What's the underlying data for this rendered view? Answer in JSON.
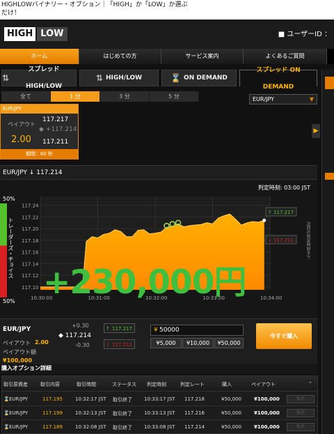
{
  "banner": {
    "line1": "HIGHLOWバイナリー・オプション｜「HIGH」か「LOW」か選ぶ",
    "line2": "だけ！"
  },
  "header": {
    "logo_high": "HIGH",
    "logo_low": "LOW",
    "user_icon": "person-icon",
    "user_label": "ユーザーID ："
  },
  "nav": [
    "ホーム",
    "はじめての方",
    "サービス案内",
    "よくあるご質問"
  ],
  "modes": [
    {
      "label": "スプレッドHIGH/LOW",
      "icon": "arrow-updown-icon"
    },
    {
      "label": "HIGH/LOW",
      "icon": "arrow-updown-icon"
    },
    {
      "label": "ON DEMAND",
      "icon": "hourglass-icon"
    },
    {
      "label": "スプレッド ON DEMAND",
      "icon": "hourglass-icon"
    }
  ],
  "periods": [
    "全て",
    "1 分",
    "3 分",
    "5 分"
  ],
  "pair_select": "EUR/JPY",
  "card": {
    "pair": "EUR/JPY",
    "high_price": "117.217",
    "mid_price": "117.214",
    "low_price": "117.211",
    "payout_label": "ペイアウト",
    "payout_value": "2.00",
    "period": "期間：60 秒"
  },
  "chart_header": {
    "pair": "EUR/JPY",
    "rate": "117.214",
    "judge_label": "判定時刻:",
    "judge_time": "03:00 JST"
  },
  "traders_choice": {
    "label": "トレーダーズ・チョイス",
    "top_pct": "50%",
    "bottom_pct": "50%",
    "up_ratio": 0.5,
    "side_text": "次回の判定時刻まで"
  },
  "chart_data": {
    "type": "area",
    "title": "",
    "xlabel": "",
    "ylabel": "",
    "x_ticks": [
      "10:30:00",
      "10:31:00",
      "10:32:00",
      "10:33:00",
      "10:34:00"
    ],
    "y_ticks": [
      "117.24",
      "117.22",
      "117.20",
      "117.18",
      "117.16",
      "117.14",
      "117.12",
      "117.10"
    ],
    "ylim": [
      117.095,
      117.255
    ],
    "xlim": [
      0,
      240
    ],
    "x": [
      0,
      44,
      48,
      54,
      60,
      66,
      72,
      78,
      84,
      90,
      96,
      102,
      108,
      114,
      120,
      126,
      132,
      138,
      144,
      150,
      156,
      162,
      168,
      174,
      180,
      186,
      192,
      198,
      204,
      210,
      216,
      222,
      228,
      234
    ],
    "values": [
      117.1,
      117.1,
      117.178,
      117.186,
      117.184,
      117.19,
      117.192,
      117.198,
      117.195,
      117.186,
      117.186,
      117.197,
      117.198,
      117.191,
      117.192,
      117.194,
      117.202,
      117.204,
      117.208,
      117.203,
      117.205,
      117.206,
      117.207,
      117.21,
      117.208,
      117.218,
      117.222,
      117.225,
      117.216,
      117.206,
      117.21,
      117.212,
      117.211,
      117.214
    ],
    "high_marker": "117.217",
    "low_marker": "117.211",
    "overlay_text": "+230,000円",
    "grid": true
  },
  "trade": {
    "pair": "EUR/JPY",
    "spread_up": "+0.30",
    "rate": "117.214",
    "spread_down": "-0.30",
    "high_price": "117.217",
    "low_price": "117.211",
    "payout_label": "ペイアウト",
    "payout_value": "2.00",
    "amount_label": "ペイアウト額",
    "amount_value": "¥100,000",
    "input_value": "50000",
    "quick_amounts": [
      "¥5,000",
      "¥10,000",
      "¥50,000"
    ],
    "buy_label": "今すぐ購入"
  },
  "table": {
    "title": "購入オプション詳細",
    "columns": [
      "取引原資産",
      "取引内容",
      "取引時間",
      "ステータス",
      "判定時刻",
      "判定レート",
      "購入",
      "ペイアウト"
    ],
    "rows": [
      {
        "asset": "EUR/JPY",
        "content": "117.195",
        "time": "10:32:17 JST",
        "status": "取引終了",
        "judge": "10:33:17 JST",
        "rate": "117.218",
        "buy": "¥50,000",
        "payout": "¥100,000",
        "action": "転売"
      },
      {
        "asset": "EUR/JPY",
        "content": "117.199",
        "time": "10:32:13 JST",
        "status": "取引終了",
        "judge": "10:33:13 JST",
        "rate": "117.216",
        "buy": "¥50,000",
        "payout": "¥100,000",
        "action": "転売"
      },
      {
        "asset": "EUR/JPY",
        "content": "117.189",
        "time": "10:32:08 JST",
        "status": "取引終了",
        "judge": "10:33:08 JST",
        "rate": "117.214",
        "buy": "¥50,000",
        "payout": "¥100,000",
        "action": "転売"
      }
    ]
  },
  "colors": {
    "accent": "#f59c1a",
    "high": "#55c12d",
    "low": "#d82020",
    "overlay": "#3fbf3f"
  }
}
